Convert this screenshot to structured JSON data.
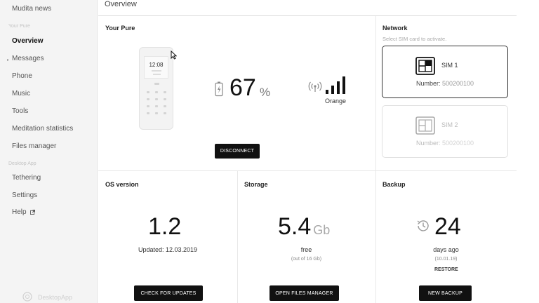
{
  "sidebar": {
    "news": "Mudita news",
    "section_pure": "Your Pure",
    "items": [
      {
        "label": "Overview"
      },
      {
        "label": "Messages"
      },
      {
        "label": "Phone"
      },
      {
        "label": "Music"
      },
      {
        "label": "Tools"
      },
      {
        "label": "Meditation statistics"
      },
      {
        "label": "Files manager"
      }
    ],
    "section_desktop": "Desktop App",
    "desktop_items": [
      {
        "label": "Tethering"
      },
      {
        "label": "Settings"
      },
      {
        "label": "Help"
      }
    ],
    "brand": "DesktopApp"
  },
  "header": {
    "title": "Overview"
  },
  "your_pure": {
    "title": "Your Pure",
    "phone_time": "12:08",
    "battery_value": "67",
    "battery_unit": "%",
    "battery_level": 0.67,
    "carrier": "Orange",
    "disconnect_label": "DISCONNECT"
  },
  "network": {
    "title": "Network",
    "subtitle": "Select SIM card to activate.",
    "sims": [
      {
        "label": "SIM 1",
        "number_label": "Number:",
        "number": "500200100",
        "active": true
      },
      {
        "label": "SIM 2",
        "number_label": "Number:",
        "number": "500200100",
        "active": false
      }
    ]
  },
  "os": {
    "title": "OS version",
    "version": "1.2",
    "updated": "Updated: 12.03.2019",
    "button": "CHECK FOR UPDATES"
  },
  "storage": {
    "title": "Storage",
    "value": "5.4",
    "unit": "Gb",
    "free_label": "free",
    "total": "(out of 16 Gb)",
    "button": "OPEN FILES MANAGER"
  },
  "backup": {
    "title": "Backup",
    "days": "24",
    "days_label": "days ago",
    "date": "(10.01.19)",
    "restore": "RESTORE",
    "button": "NEW BACKUP"
  },
  "colors": {
    "accent": "#111111",
    "sidebar_bg": "#f4f4f4",
    "border": "#e8e8e8"
  }
}
